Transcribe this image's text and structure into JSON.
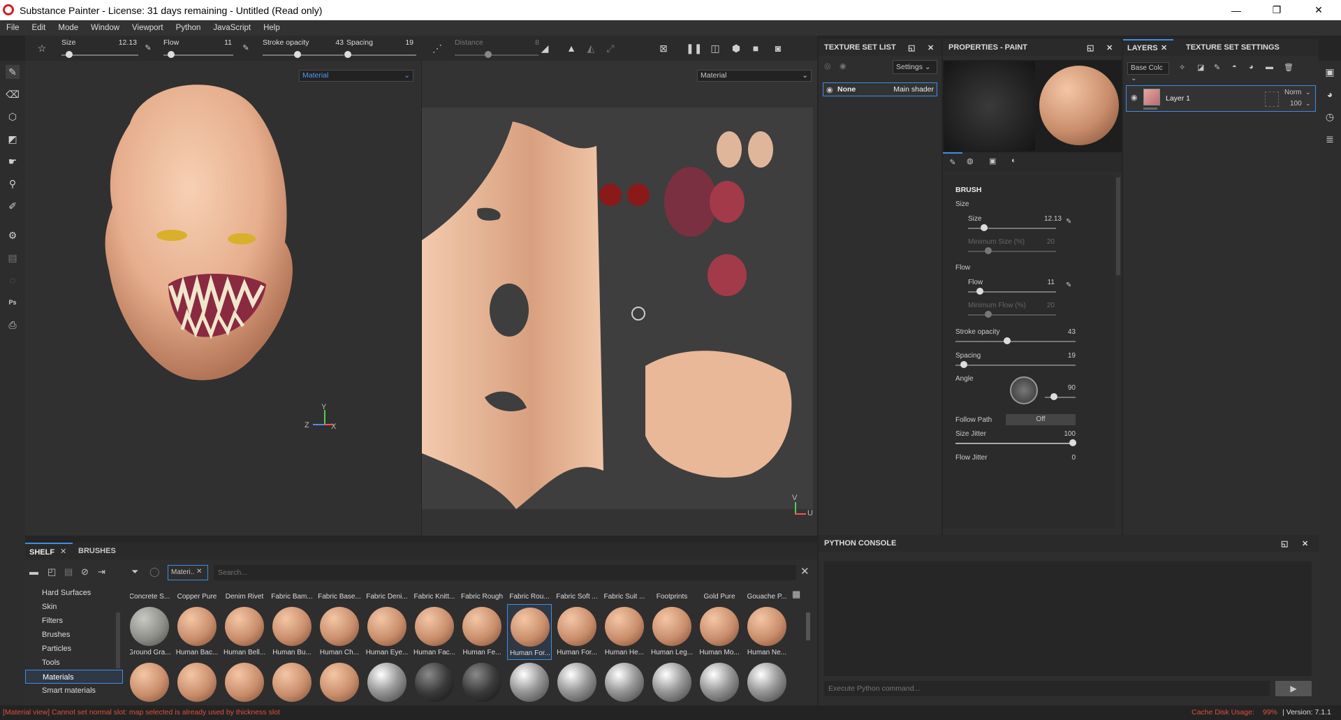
{
  "window": {
    "title": "Substance Painter - License: 31 days remaining - Untitled (Read only)",
    "minimize": "—",
    "restore": "❐",
    "close": "✕"
  },
  "menu": [
    "File",
    "Edit",
    "Mode",
    "Window",
    "Viewport",
    "Python",
    "JavaScript",
    "Help"
  ],
  "toolbar": {
    "size_label": "Size",
    "size_value": "12.13",
    "size_level": 0.1,
    "flow_label": "Flow",
    "flow_value": "11",
    "flow_level": 0.11,
    "opacity_label": "Stroke opacity",
    "opacity_value": "43",
    "opacity_level": 0.43,
    "spacing_label": "Spacing",
    "spacing_value": "19",
    "spacing_level": 0.02,
    "distance_label": "Distance",
    "distance_value": "8",
    "distance_level": 0.4
  },
  "viewport3d": {
    "channel": "Material"
  },
  "viewport2d": {
    "channel": "Material"
  },
  "texture_set_list": {
    "title": "TEXTURE SET LIST",
    "settings": "Settings",
    "row_name": "None",
    "row_shader": "Main shader"
  },
  "properties": {
    "title": "PROPERTIES - PAINT",
    "section": "BRUSH",
    "size_group": "Size",
    "size_label": "Size",
    "size_value": "12.13",
    "min_size_label": "Minimum Size (%)",
    "min_size_value": "20",
    "flow_group": "Flow",
    "flow_label": "Flow",
    "flow_value": "11",
    "min_flow_label": "Minimum Flow (%)",
    "min_flow_value": "20",
    "opacity_label": "Stroke opacity",
    "opacity_value": "43",
    "spacing_label": "Spacing",
    "spacing_value": "19",
    "angle_label": "Angle",
    "angle_value": "90",
    "follow_path_label": "Follow Path",
    "follow_path_value": "Off",
    "size_jitter_label": "Size Jitter",
    "size_jitter_value": "100",
    "flow_jitter_label": "Flow Jitter",
    "flow_jitter_value": "0"
  },
  "layers": {
    "tab_layers": "LAYERS",
    "tab_texset": "TEXTURE SET SETTINGS",
    "channel": "Base Colc",
    "layer_name": "Layer 1",
    "blend": "Norm",
    "opacity": "100"
  },
  "shelf": {
    "tab_shelf": "SHELF",
    "tab_brushes": "BRUSHES",
    "filter_tag": "Materi..",
    "search_placeholder": "Search...",
    "categories": [
      "Hard Surfaces",
      "Skin",
      "Filters",
      "Brushes",
      "Particles",
      "Tools",
      "Materials",
      "Smart materials"
    ],
    "selected_category": "Materials",
    "row1": [
      "Concrete S...",
      "Copper Pure",
      "Denim Rivet",
      "Fabric Bam...",
      "Fabric Base...",
      "Fabric Deni...",
      "Fabric Knitt...",
      "Fabric Rough",
      "Fabric Rou...",
      "Fabric Soft ...",
      "Fabric Suit ...",
      "Footprints",
      "Gold Pure",
      "Gouache P..."
    ],
    "row2": [
      "Ground Gra...",
      "Human Bac...",
      "Human Bell...",
      "Human Bu...",
      "Human Ch...",
      "Human Eye...",
      "Human Fac...",
      "Human Fe...",
      "Human For...",
      "Human For...",
      "Human He...",
      "Human Leg...",
      "Human Mo...",
      "Human Ne..."
    ]
  },
  "python_console": {
    "title": "PYTHON CONSOLE",
    "placeholder": "Execute Python command..."
  },
  "status": {
    "message": "[Material view] Cannot set normal slot: map selected is already used by thickness slot",
    "cache_label": "Cache Disk Usage:",
    "cache_value": "99%",
    "version": "| Version: 7.1.1"
  },
  "axes3d": {
    "y": "Y",
    "z": "Z",
    "x": "X"
  },
  "axes2d": {
    "v": "V",
    "u": "U"
  },
  "colors": {
    "accent": "#3d8ee8",
    "status_error": "#e0503a",
    "skin": "#e8b898"
  }
}
